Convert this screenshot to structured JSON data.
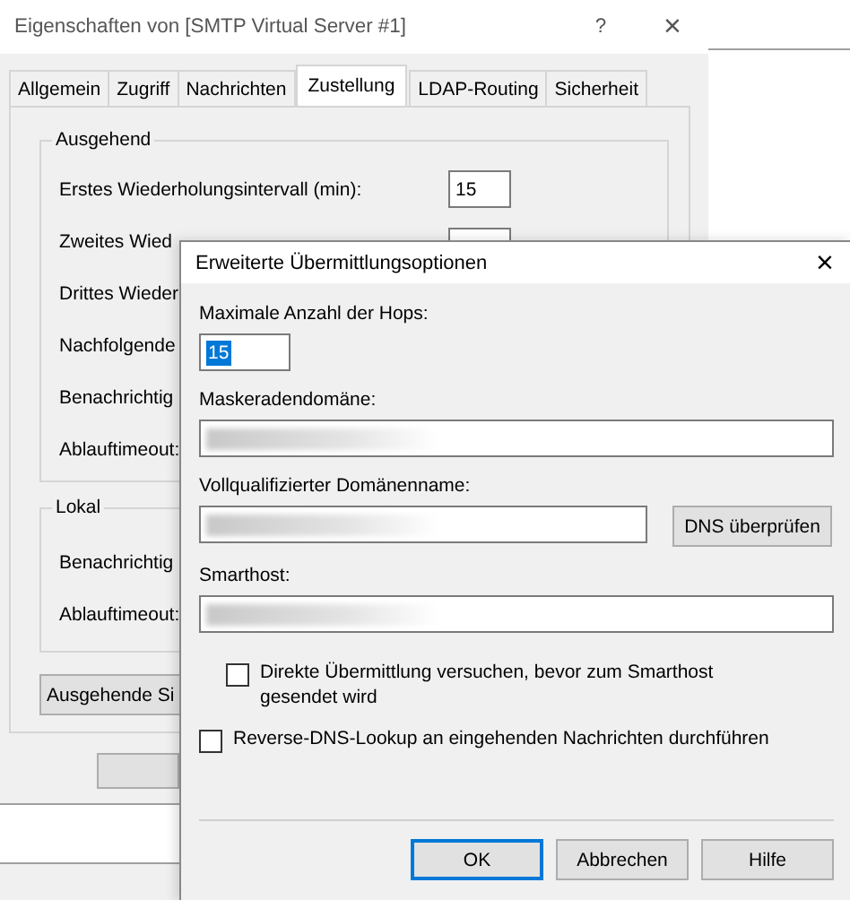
{
  "back_window": {
    "title": "Eigenschaften von [SMTP Virtual Server #1]",
    "help_button": "?",
    "close_button": "×",
    "tabs": [
      {
        "label": "Allgemein",
        "selected": false
      },
      {
        "label": "Zugriff",
        "selected": false
      },
      {
        "label": "Nachrichten",
        "selected": false
      },
      {
        "label": "Zustellung",
        "selected": true
      },
      {
        "label": "LDAP-Routing",
        "selected": false
      },
      {
        "label": "Sicherheit",
        "selected": false
      }
    ],
    "outgoing_group": {
      "title": "Ausgehend",
      "rows": [
        {
          "label": "Erstes Wiederholungsintervall (min):",
          "value": "15"
        },
        {
          "label": "Zweites Wied",
          "has_field": true
        },
        {
          "label": "Drittes Wieder"
        },
        {
          "label": "Nachfolgende"
        },
        {
          "label": "Benachrichtig"
        },
        {
          "label": "Ablauftimeout:"
        }
      ]
    },
    "local_group": {
      "title": "Lokal",
      "rows": [
        {
          "label": "Benachrichtig"
        },
        {
          "label": "Ablauftimeout:"
        }
      ]
    },
    "security_button": "Ausgehende Si"
  },
  "dialog": {
    "title": "Erweiterte Übermittlungsoptionen",
    "close_button": "×",
    "fields": [
      {
        "label": "Maximale Anzahl der Hops:",
        "value": "15",
        "selected": true,
        "kind": "short"
      },
      {
        "label": "Maskeradendomäne:",
        "redacted": true,
        "kind": "wide"
      },
      {
        "label": "Vollqualifizierter Domänenname:",
        "redacted": true,
        "kind": "with_button",
        "button": "DNS überprüfen"
      },
      {
        "label": "Smarthost:",
        "redacted": true,
        "kind": "wide"
      }
    ],
    "checkboxes": [
      {
        "label": "Direkte Übermittlung versuchen, bevor zum Smarthost gesendet wird",
        "checked": false,
        "kind": "indented"
      },
      {
        "label": "Reverse-DNS-Lookup an eingehenden Nachrichten durchführen",
        "checked": false,
        "kind": "plain"
      }
    ],
    "buttons": [
      "OK",
      "Abbrechen",
      "Hilfe"
    ]
  }
}
